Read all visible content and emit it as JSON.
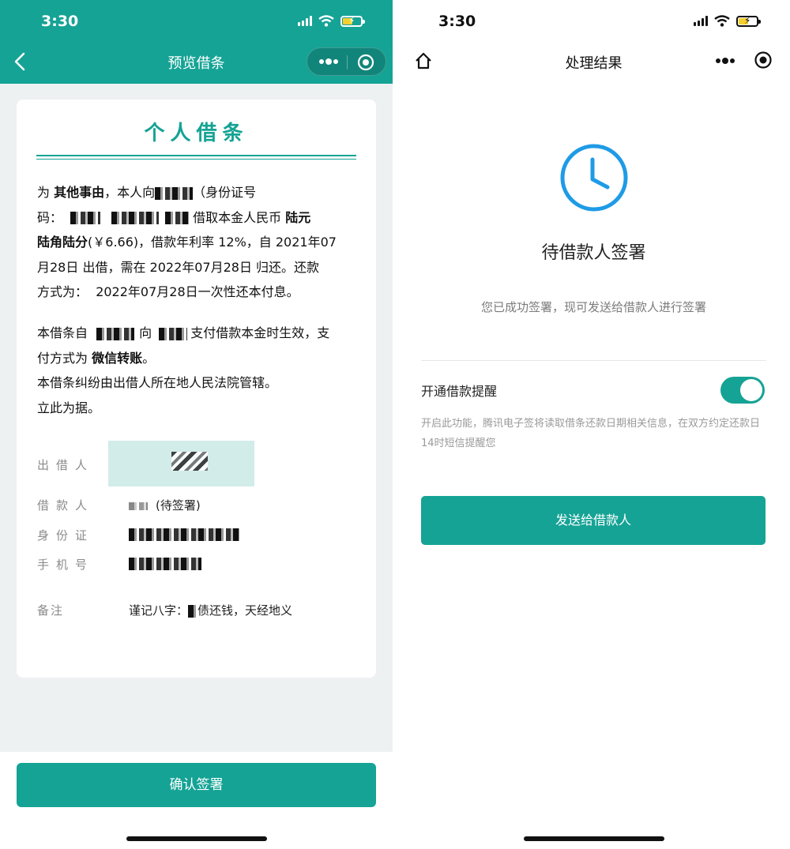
{
  "status": {
    "time": "3:30"
  },
  "left": {
    "nav_title": "预览借条",
    "doc_title": "个人借条",
    "p1": {
      "a": "为",
      "reason": "其他事由",
      "b": "，本人向",
      "c": "（身份证号",
      "d": "码：",
      "e": "借取本金人民币",
      "amount_words_1": "陆元",
      "amount_words_2": "陆角陆分",
      "amount_num": "(￥6.66)",
      "f": "，借款年利率 12%，自 2021年07",
      "g": "月28日 出借，需在 2022年07月28日 归还。还款",
      "h": "方式为：",
      "method": "2022年07月28日一次性还本付息。"
    },
    "p2": {
      "a": "本借条自",
      "b": "向",
      "c": "支付借款本金时生效，支",
      "d": "付方式为",
      "pay": "微信转账",
      "e": "。",
      "line2": "本借条纠纷由出借人所在地人民法院管辖。",
      "line3": "立此为据。"
    },
    "fields": {
      "lender_label": "出借人",
      "borrower_label": "借款人",
      "borrower_value": "(待签署)",
      "id_label": "身份证",
      "phone_label": "手机号",
      "note_label": "备注",
      "note_value_a": "谨记八字：",
      "note_value_b": "债还钱，天经地义"
    },
    "confirm_button": "确认签署"
  },
  "right": {
    "nav_title": "处理结果",
    "result_title": "待借款人签署",
    "result_desc": "您已成功签署，现可发送给借款人进行签署",
    "toggle_label": "开通借款提醒",
    "toggle_on": true,
    "toggle_desc": "开启此功能，腾讯电子签将读取借条还款日期相关信息，在双方约定还款日14时短信提醒您",
    "send_button": "发送给借款人"
  },
  "colors": {
    "accent": "#15a395",
    "page_bg": "#edf1f1"
  },
  "icons": [
    "back-arrow-icon",
    "more-dots-icon",
    "target-icon",
    "home-icon",
    "clock-icon",
    "wifi-icon",
    "signal-icon",
    "battery-icon"
  ]
}
